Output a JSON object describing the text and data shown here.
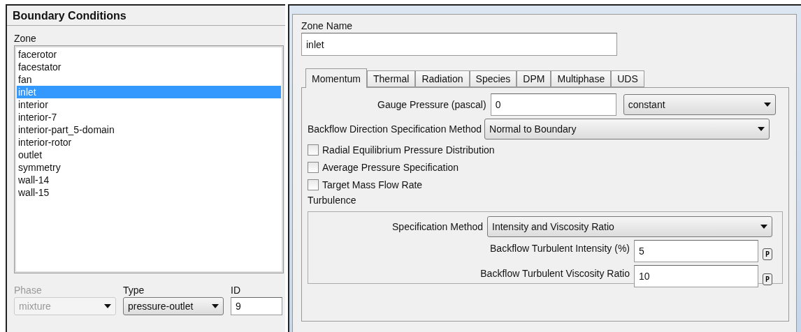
{
  "left_panel": {
    "title": "Boundary Conditions",
    "zone_label": "Zone",
    "zones": [
      {
        "label": "facerotor",
        "selected": false
      },
      {
        "label": "facestator",
        "selected": false
      },
      {
        "label": "fan",
        "selected": false
      },
      {
        "label": "inlet",
        "selected": true
      },
      {
        "label": "interior",
        "selected": false
      },
      {
        "label": "interior-7",
        "selected": false
      },
      {
        "label": "interior-part_5-domain",
        "selected": false
      },
      {
        "label": "interior-rotor",
        "selected": false
      },
      {
        "label": "outlet",
        "selected": false
      },
      {
        "label": "symmetry",
        "selected": false
      },
      {
        "label": "wall-14",
        "selected": false
      },
      {
        "label": "wall-15",
        "selected": false
      }
    ],
    "phase": {
      "label": "Phase",
      "value": "mixture",
      "disabled": true
    },
    "type": {
      "label": "Type",
      "value": "pressure-outlet",
      "disabled": false
    },
    "id": {
      "label": "ID",
      "value": "9"
    }
  },
  "right_panel": {
    "zone_name": {
      "label": "Zone Name",
      "value": "inlet"
    },
    "tabs": [
      {
        "label": "Momentum",
        "selected": true
      },
      {
        "label": "Thermal",
        "selected": false
      },
      {
        "label": "Radiation",
        "selected": false
      },
      {
        "label": "Species",
        "selected": false
      },
      {
        "label": "DPM",
        "selected": false
      },
      {
        "label": "Multiphase",
        "selected": false
      },
      {
        "label": "UDS",
        "selected": false
      }
    ],
    "gauge_pressure": {
      "label": "Gauge Pressure (pascal)",
      "value": "0",
      "profile": "constant"
    },
    "backflow_direction": {
      "label": "Backflow Direction Specification Method",
      "value": "Normal to Boundary"
    },
    "checkboxes": [
      {
        "label": "Radial Equilibrium Pressure Distribution",
        "checked": false
      },
      {
        "label": "Average Pressure Specification",
        "checked": false
      },
      {
        "label": "Target Mass Flow Rate",
        "checked": false
      }
    ],
    "turbulence": {
      "title": "Turbulence",
      "method_label": "Specification Method",
      "method": "Intensity and Viscosity Ratio",
      "fields": [
        {
          "label": "Backflow Turbulent Intensity (%)",
          "value": "5",
          "button": "P"
        },
        {
          "label": "Backflow Turbulent Viscosity Ratio",
          "value": "10",
          "button": "P"
        }
      ]
    }
  }
}
